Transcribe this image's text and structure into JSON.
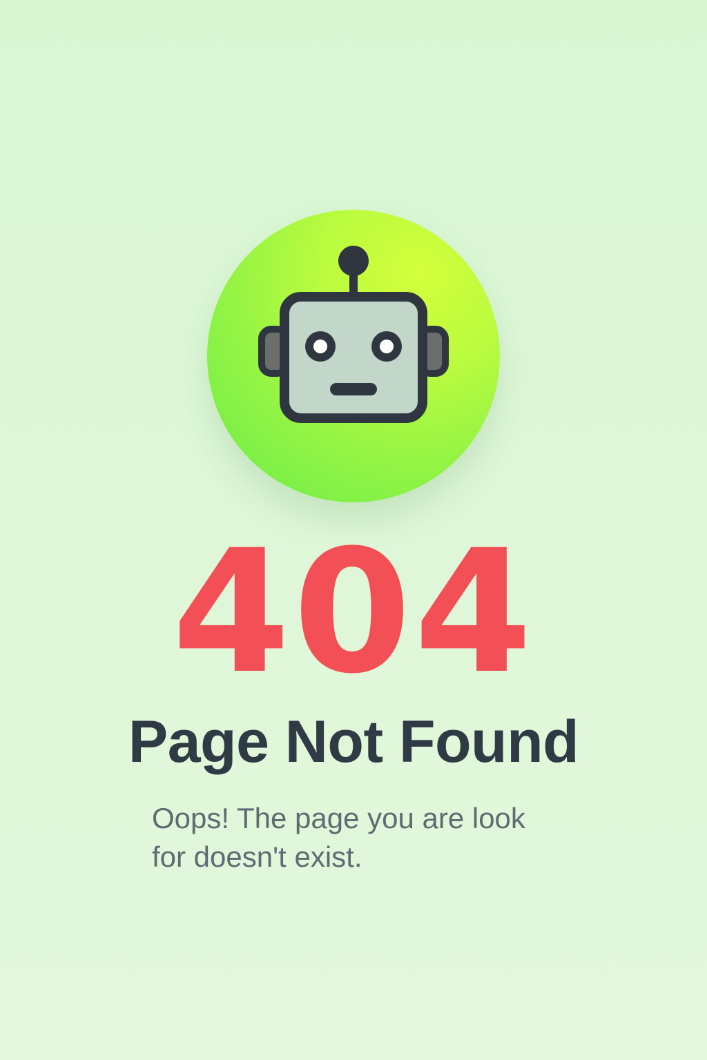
{
  "error": {
    "code": "404",
    "title": "Page Not Found",
    "message": "Oops! The page you are look\nfor doesn't exist."
  },
  "icons": {
    "robot": "robot-icon"
  },
  "colors": {
    "background": "#dff7d8",
    "badge_gradient_start": "#d4ff3b",
    "badge_gradient_end": "#6aec48",
    "error_code": "#f34f56",
    "title": "#2f3a45",
    "message": "#5f6b73",
    "robot_outline": "#2f3640",
    "robot_face": "#c3d6ca"
  }
}
